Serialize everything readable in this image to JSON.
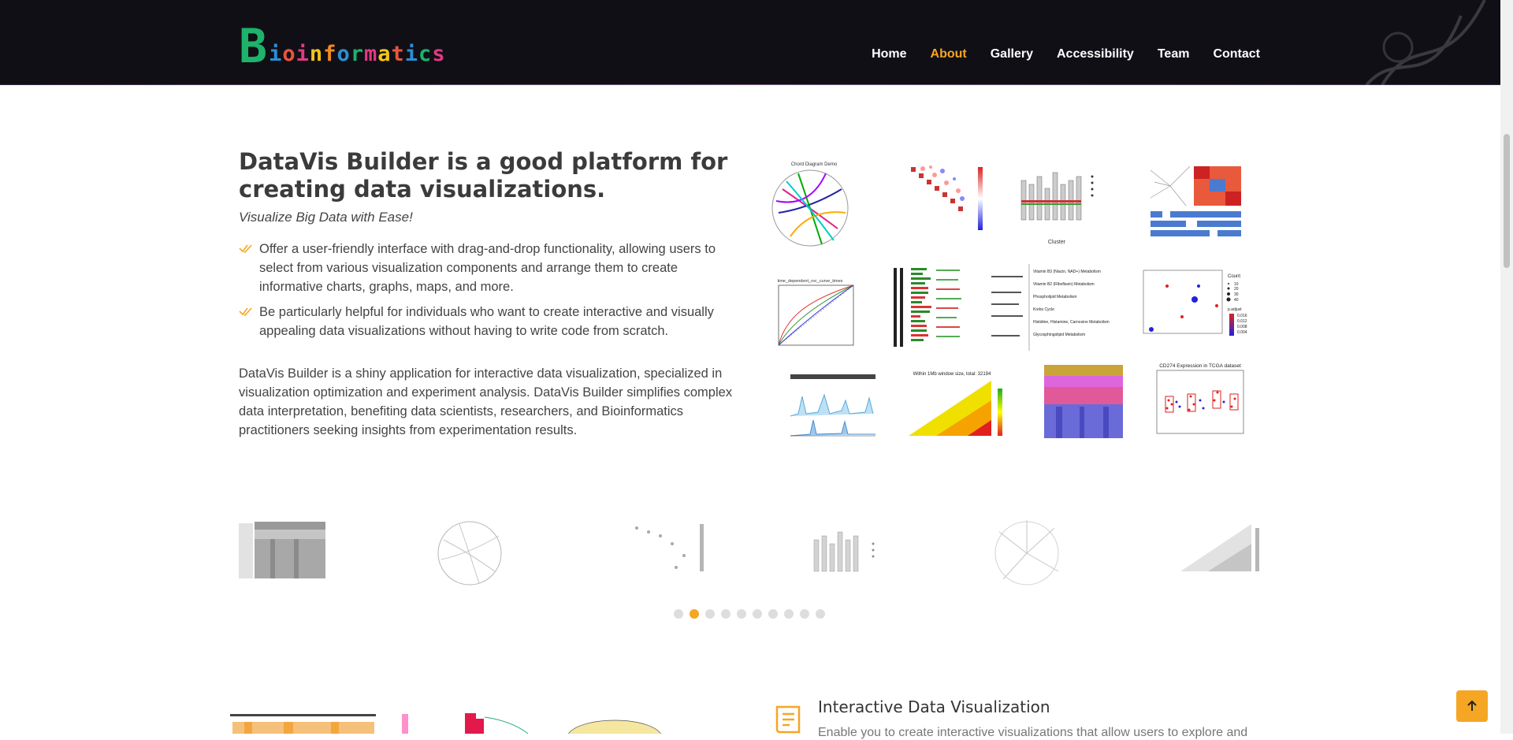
{
  "brand": {
    "logo_text": "Bioinformatics",
    "letters": [
      {
        "ch": "B",
        "color": "#1db36a"
      },
      {
        "ch": "i",
        "color": "#2b8fd6"
      },
      {
        "ch": "o",
        "color": "#e8553b"
      },
      {
        "ch": "i",
        "color": "#e23a83"
      },
      {
        "ch": "n",
        "color": "#f5c518"
      },
      {
        "ch": "f",
        "color": "#f08a24"
      },
      {
        "ch": "o",
        "color": "#2b8fd6"
      },
      {
        "ch": "r",
        "color": "#1db36a"
      },
      {
        "ch": "m",
        "color": "#e23a83"
      },
      {
        "ch": "a",
        "color": "#f5c518"
      },
      {
        "ch": "t",
        "color": "#e8553b"
      },
      {
        "ch": "i",
        "color": "#2b8fd6"
      },
      {
        "ch": "c",
        "color": "#1db36a"
      },
      {
        "ch": "s",
        "color": "#e23a83"
      }
    ]
  },
  "nav": {
    "items": [
      {
        "label": "Home",
        "active": false
      },
      {
        "label": "About",
        "active": true
      },
      {
        "label": "Gallery",
        "active": false
      },
      {
        "label": "Accessibility",
        "active": false
      },
      {
        "label": "Team",
        "active": false
      },
      {
        "label": "Contact",
        "active": false
      }
    ]
  },
  "about": {
    "title": "DataVis Builder is a good platform for creating data visualizations.",
    "subtitle": "Visualize Big Data with Ease!",
    "bullets": [
      "Offer a user-friendly interface with drag-and-drop functionality, allowing users to select from various visualization components and arrange them to create informative charts, graphs, maps, and more.",
      "Be particularly helpful for individuals who want to create interactive and visually appealing data visualizations without having to write code from scratch."
    ],
    "paragraph": "DataVis Builder is a shiny application for interactive data visualization, specialized in visualization optimization and experiment analysis. DataVis Builder simplifies complex data interpretation, benefiting data scientists, researchers, and Bioinformatics practitioners seeking insights from experimentation results."
  },
  "gallery_tiles": [
    {
      "label": "Chord Diagram Demo",
      "icon": "chord-diagram-icon"
    },
    {
      "label": "",
      "icon": "correlation-heatmap-icon"
    },
    {
      "label": "Cluster",
      "icon": "boxplot-cluster-icon"
    },
    {
      "label": "",
      "icon": "clustered-heatmap-icon"
    },
    {
      "label": "time_dependent_roc_curve_times",
      "icon": "roc-curve-icon"
    },
    {
      "label": "",
      "icon": "gene-annotation-icon"
    },
    {
      "label": "",
      "icon": "pathway-table-icon"
    },
    {
      "label": "",
      "icon": "bubble-plot-icon"
    },
    {
      "label": "",
      "icon": "peak-track-icon"
    },
    {
      "label": "Within 1Mb window size, total: 32194",
      "icon": "ld-triangle-icon"
    },
    {
      "label": "",
      "icon": "expression-heatmap-icon"
    },
    {
      "label": "CD274 Expression in TCGA dataset",
      "icon": "box-jitter-icon"
    }
  ],
  "pathway_labels": [
    "Vitamin B3 (Niacin, NAD+) Metabolism",
    "Vitamin B2 (Riboflavin) Metabolism",
    "Phospholipid Metabolism",
    "Krebs Cycle",
    "Histidine, Histamine, Carnosine Metabolism",
    "Glycosphingolipid Metabolism"
  ],
  "bubble_legend": {
    "title": "Count",
    "sizes": [
      "10",
      "20",
      "30",
      "40"
    ],
    "color_title": "p.adjust",
    "color_values": [
      "0.016",
      "0.012",
      "0.008",
      "0.004"
    ]
  },
  "carousel": {
    "items": [
      "expression-heatmap-icon",
      "chord-diagram-icon",
      "correlation-heatmap-icon",
      "boxplot-cluster-icon",
      "circular-tree-icon",
      "ld-triangle-icon"
    ],
    "dots": 10,
    "active_dot": 1
  },
  "feature": {
    "title": "Interactive Data Visualization",
    "text": "Enable you to create interactive visualizations that allow users to explore and",
    "icon": "document-icon"
  },
  "colors": {
    "accent": "#f5a623",
    "header_bg": "#110f16",
    "text": "#444444"
  }
}
